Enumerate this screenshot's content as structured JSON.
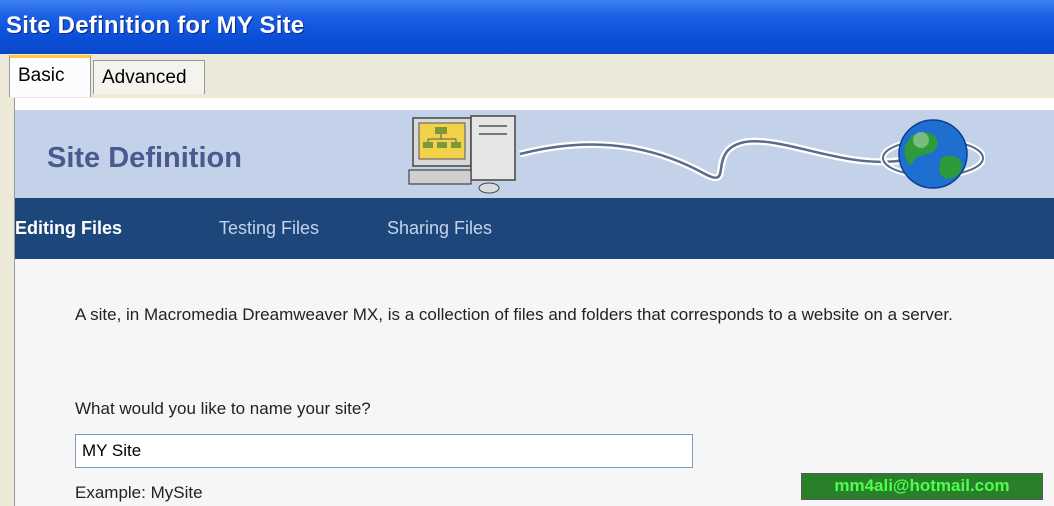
{
  "window": {
    "title": "Site Definition for MY Site"
  },
  "tabs": [
    {
      "label": "Basic",
      "active": true
    },
    {
      "label": "Advanced",
      "active": false
    }
  ],
  "banner": {
    "heading": "Site Definition",
    "icons": [
      "computer-icon",
      "network-cable-icon",
      "globe-icon"
    ]
  },
  "nav": [
    {
      "label": "Editing Files",
      "active": true
    },
    {
      "label": "Testing Files",
      "active": false
    },
    {
      "label": "Sharing Files",
      "active": false
    }
  ],
  "content": {
    "description": "A site, in Macromedia Dreamweaver MX, is a collection of files and folders that corresponds to a website on a server.",
    "question": "What would you like to name your site?",
    "site_name_value": "MY Site",
    "example": "Example: MySite"
  },
  "watermark": "mm4ali@hotmail.com",
  "colors": {
    "titlebar": "#0b4fd8",
    "banner": "#c4d2e9",
    "navbar": "#1d477b",
    "tab_highlight": "#ffc83c"
  }
}
